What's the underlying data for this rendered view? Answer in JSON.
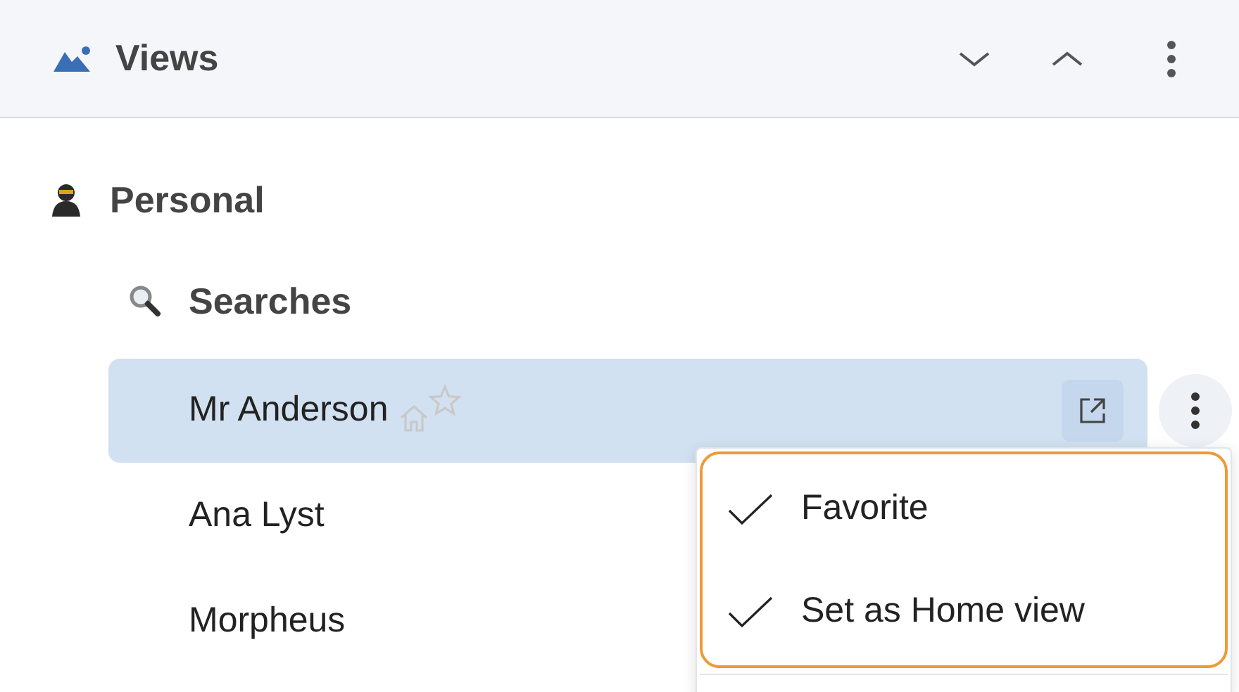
{
  "header": {
    "title": "Views"
  },
  "tree": [
    {
      "label": "Personal",
      "kind": "person",
      "children": [
        {
          "label": "Searches",
          "kind": "search",
          "children": [
            {
              "label": "Mr Anderson",
              "selected": true
            },
            {
              "label": "Ana Lyst",
              "selected": false
            },
            {
              "label": "Morpheus",
              "selected": false
            }
          ]
        }
      ]
    }
  ],
  "menu": {
    "items": [
      {
        "label": "Favorite",
        "checked": true
      },
      {
        "label": "Set as Home view",
        "checked": true
      }
    ]
  }
}
